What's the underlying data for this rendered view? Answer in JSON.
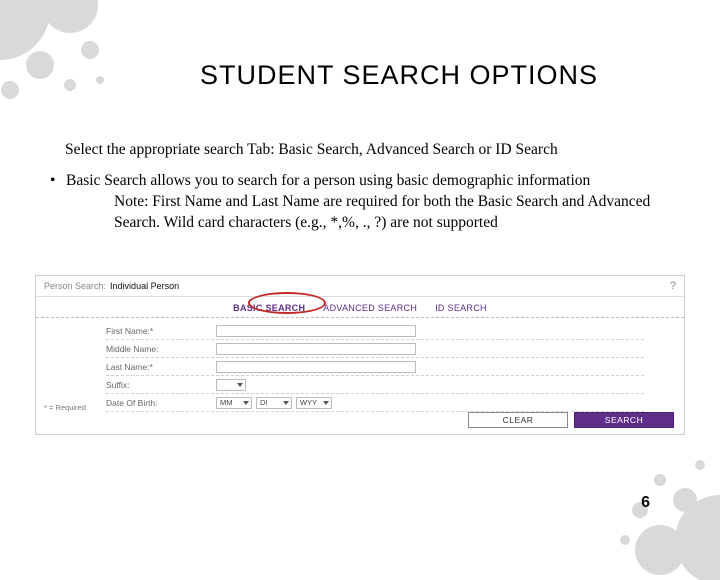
{
  "title": "STUDENT SEARCH OPTIONS",
  "para1": "Select the appropriate search Tab: Basic Search, Advanced Search or ID Search",
  "bullet": "Basic Search allows you to search for a person using basic demographic information",
  "note": "Note: First Name and Last Name are required for both the Basic Search and Advanced Search. Wild card characters (e.g., *,%, ., ?) are not supported",
  "ps": {
    "header_muted": "Person Search:",
    "header_bold": "Individual Person",
    "help": "?",
    "tabs": {
      "basic": "BASIC SEARCH",
      "advanced": "ADVANCED SEARCH",
      "id": "ID SEARCH"
    },
    "fields": {
      "first": "First Name:*",
      "middle": "Middle Name:",
      "last": "Last Name:*",
      "suffix": "Suffix:",
      "dob": "Date Of Birth:"
    },
    "dob_values": {
      "m": "MM",
      "d": "DI",
      "y": "WYY"
    },
    "required_note": "* = Required",
    "buttons": {
      "clear": "CLEAR",
      "search": "SEARCH"
    }
  },
  "page_number": "6"
}
